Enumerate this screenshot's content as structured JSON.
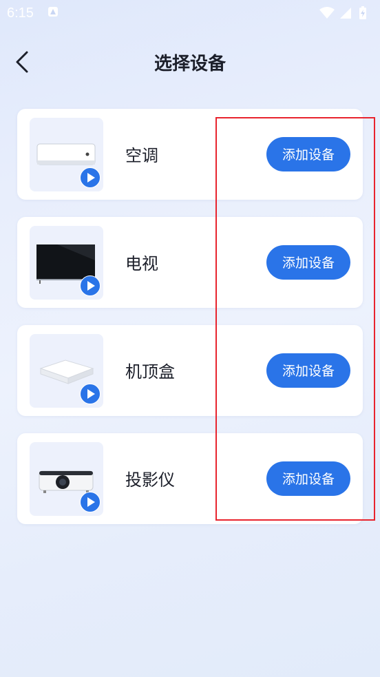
{
  "status_bar": {
    "time": "6:15"
  },
  "header": {
    "title": "选择设备"
  },
  "devices": [
    {
      "name": "空调",
      "button_label": "添加设备",
      "image": "air-conditioner"
    },
    {
      "name": "电视",
      "button_label": "添加设备",
      "image": "television"
    },
    {
      "name": "机顶盒",
      "button_label": "添加设备",
      "image": "set-top-box"
    },
    {
      "name": "投影仪",
      "button_label": "添加设备",
      "image": "projector"
    }
  ],
  "colors": {
    "accent": "#2a74e8",
    "highlight": "#e8232d",
    "card": "#ffffff",
    "thumb_bg": "#edf1fc"
  }
}
